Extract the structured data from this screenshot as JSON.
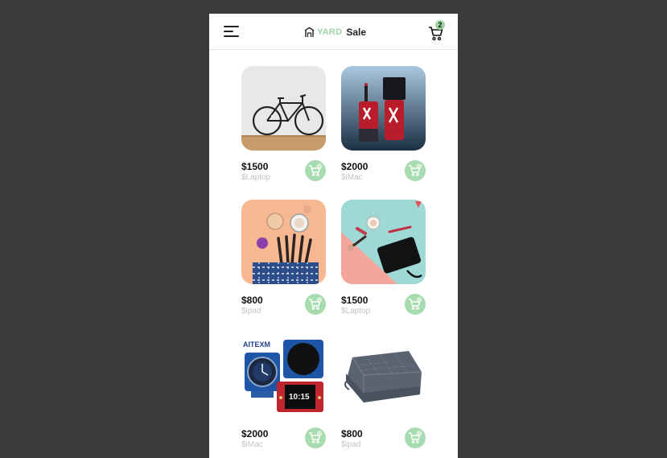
{
  "app": {
    "logo_word_1": "YARD",
    "logo_word_2": "Sale",
    "cart_count": "2"
  },
  "colors": {
    "accent": "#a7dbb0",
    "background": "#3b3b3b",
    "card": "#ffffff"
  },
  "products": [
    {
      "price": "$1500",
      "name": "$Laptop",
      "image": "bicycle"
    },
    {
      "price": "$2000",
      "name": "$iMac",
      "image": "nail-polish"
    },
    {
      "price": "$800",
      "name": "$ipad",
      "image": "makeup-bag"
    },
    {
      "price": "$1500",
      "name": "$Laptop",
      "image": "cosmetics-wallet"
    },
    {
      "price": "$2000",
      "name": "$iMac",
      "image": "electronics-modules",
      "image_text": "AITEXM"
    },
    {
      "price": "$800",
      "name": "$ipad",
      "image": "weighted-blanket"
    }
  ]
}
